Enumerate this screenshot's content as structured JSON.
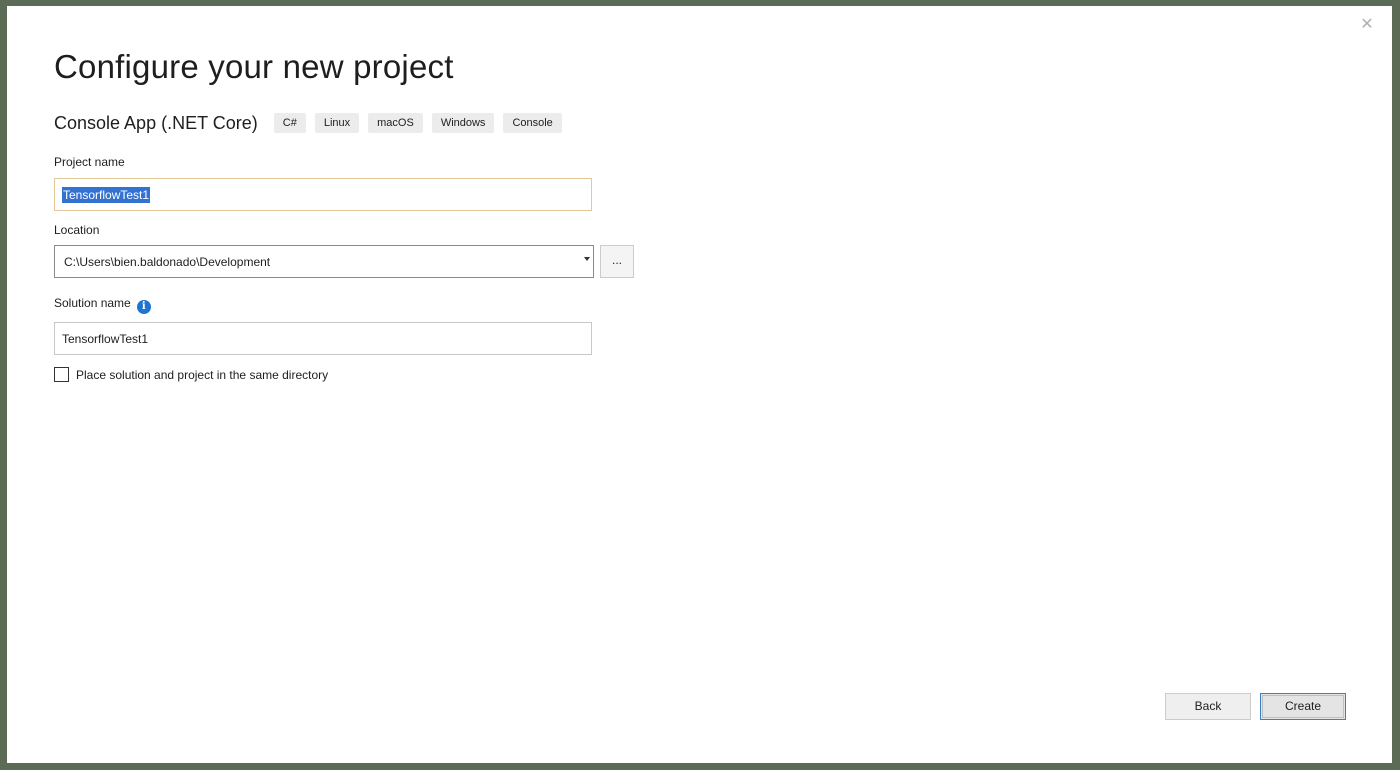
{
  "dialog": {
    "close_glyph": "✕",
    "title": "Configure your new project",
    "template": {
      "name": "Console App (.NET Core)",
      "tags": [
        "C#",
        "Linux",
        "macOS",
        "Windows",
        "Console"
      ]
    },
    "project_name": {
      "label": "Project name",
      "value": "TensorflowTest1"
    },
    "location": {
      "label": "Location",
      "value": "C:\\Users\\bien.baldonado\\Development",
      "browse_label": "..."
    },
    "solution_name": {
      "label": "Solution name",
      "value": "TensorflowTest1",
      "info_glyph": "i"
    },
    "same_directory": {
      "label": "Place solution and project in the same directory",
      "checked": false
    },
    "buttons": {
      "back": "Back",
      "create": "Create"
    }
  },
  "colors": {
    "accent": "#3372d0",
    "info_icon": "#1e74d0",
    "focus_border": "#e3c89a",
    "background_frame": "#5b6b55"
  },
  "icons": {
    "close": "close-icon",
    "info": "info-icon",
    "dropdown": "chevron-down-icon"
  }
}
